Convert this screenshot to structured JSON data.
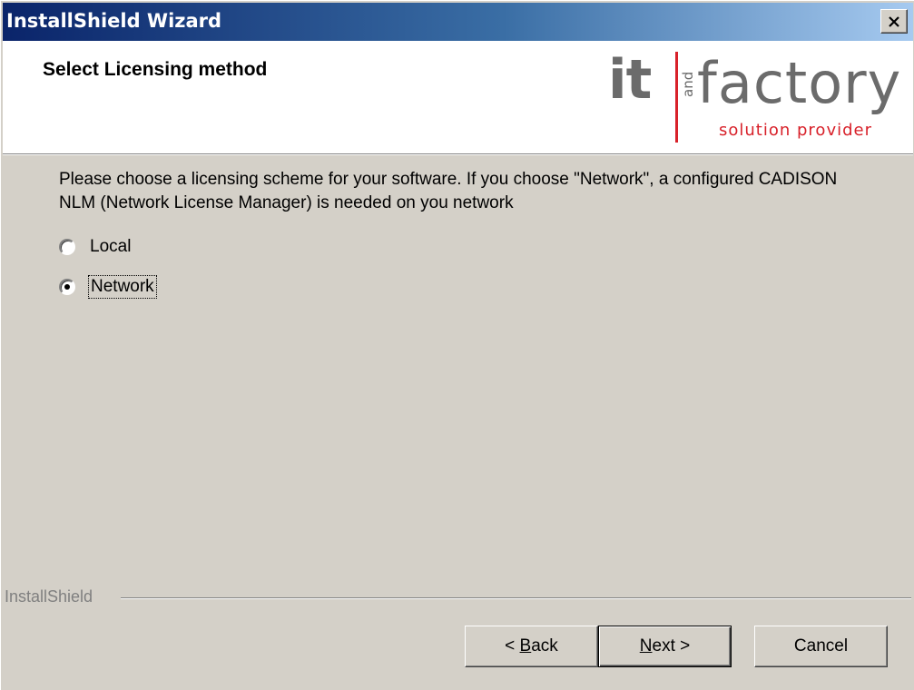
{
  "window": {
    "title": "InstallShield Wizard",
    "close_icon": "close-icon"
  },
  "header": {
    "title": "Select Licensing method",
    "logo": {
      "it": "it",
      "and": "and",
      "factory": "factory",
      "tagline": "solution provider"
    }
  },
  "body": {
    "description": "Please choose a licensing scheme for your software. If you choose \"Network\", a configured CADISON NLM (Network License Manager) is needed on you network",
    "options": [
      {
        "label": "Local",
        "checked": false
      },
      {
        "label": "Network",
        "checked": true
      }
    ]
  },
  "footer": {
    "brand": "InstallShield",
    "buttons": {
      "back_prefix": "< ",
      "back_mnemonic": "B",
      "back_rest": "ack",
      "next_mnemonic": "N",
      "next_rest": "ext >",
      "cancel": "Cancel"
    }
  }
}
